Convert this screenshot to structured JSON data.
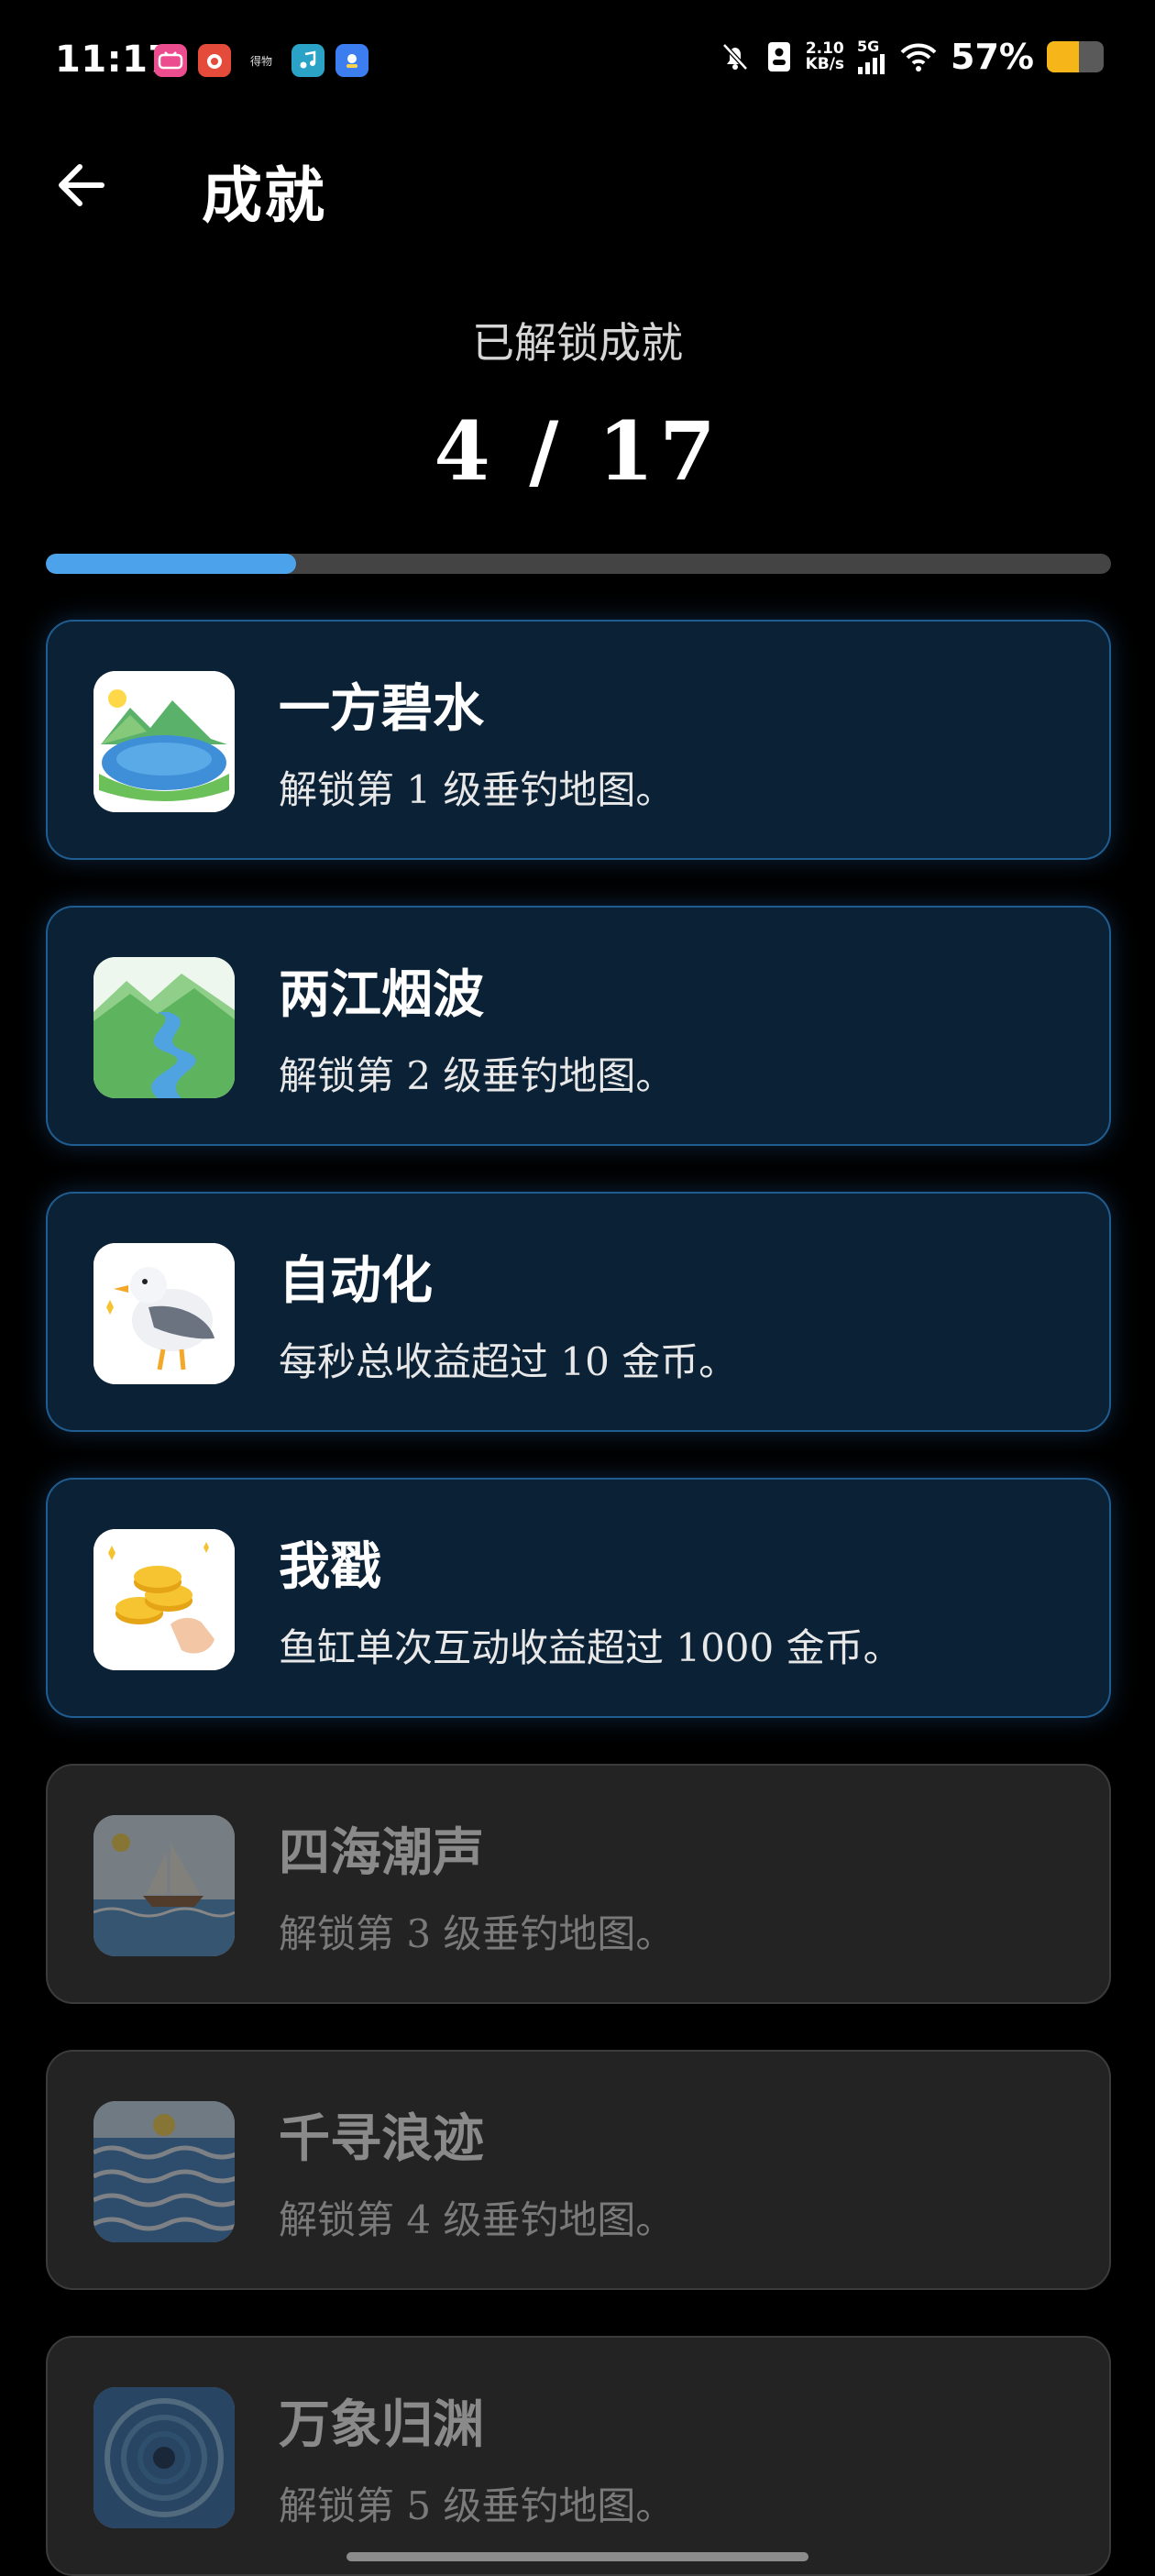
{
  "status_bar": {
    "time": "11:17",
    "app_icons": [
      {
        "name": "bilibili-app-icon",
        "label": "bilibili"
      },
      {
        "name": "red-app-icon",
        "label": ""
      },
      {
        "name": "text-app-icon",
        "label": "得物"
      },
      {
        "name": "music-app-icon",
        "label": ""
      },
      {
        "name": "blue-app-icon",
        "label": ""
      }
    ],
    "net_speed_value": "2.10",
    "net_speed_unit": "KB/s",
    "network_type": "5G",
    "battery_percent": "57%",
    "battery_level": 0.57,
    "battery_color": "#f6b518"
  },
  "header": {
    "title": "成就"
  },
  "summary": {
    "label": "已解锁成就",
    "count_text": "4 / 17",
    "unlocked": 4,
    "total": 17,
    "progress_color": "#4ca3ec"
  },
  "achievements": [
    {
      "title": "一方碧水",
      "desc": "解锁第 1 级垂钓地图。",
      "icon": "lake-icon",
      "unlocked": true
    },
    {
      "title": "两江烟波",
      "desc": "解锁第 2 级垂钓地图。",
      "icon": "river-icon",
      "unlocked": true
    },
    {
      "title": "自动化",
      "desc": "每秒总收益超过 10 金币。",
      "icon": "seagull-icon",
      "unlocked": true
    },
    {
      "title": "我戳",
      "desc": "鱼缸单次互动收益超过 1000 金币。",
      "icon": "coins-icon",
      "unlocked": true
    },
    {
      "title": "四海潮声",
      "desc": "解锁第 3 级垂钓地图。",
      "icon": "sailboat-icon",
      "unlocked": false
    },
    {
      "title": "千寻浪迹",
      "desc": "解锁第 4 级垂钓地图。",
      "icon": "waves-icon",
      "unlocked": false
    },
    {
      "title": "万象归渊",
      "desc": "解锁第 5 级垂钓地图。",
      "icon": "whirlpool-icon",
      "unlocked": false
    }
  ]
}
